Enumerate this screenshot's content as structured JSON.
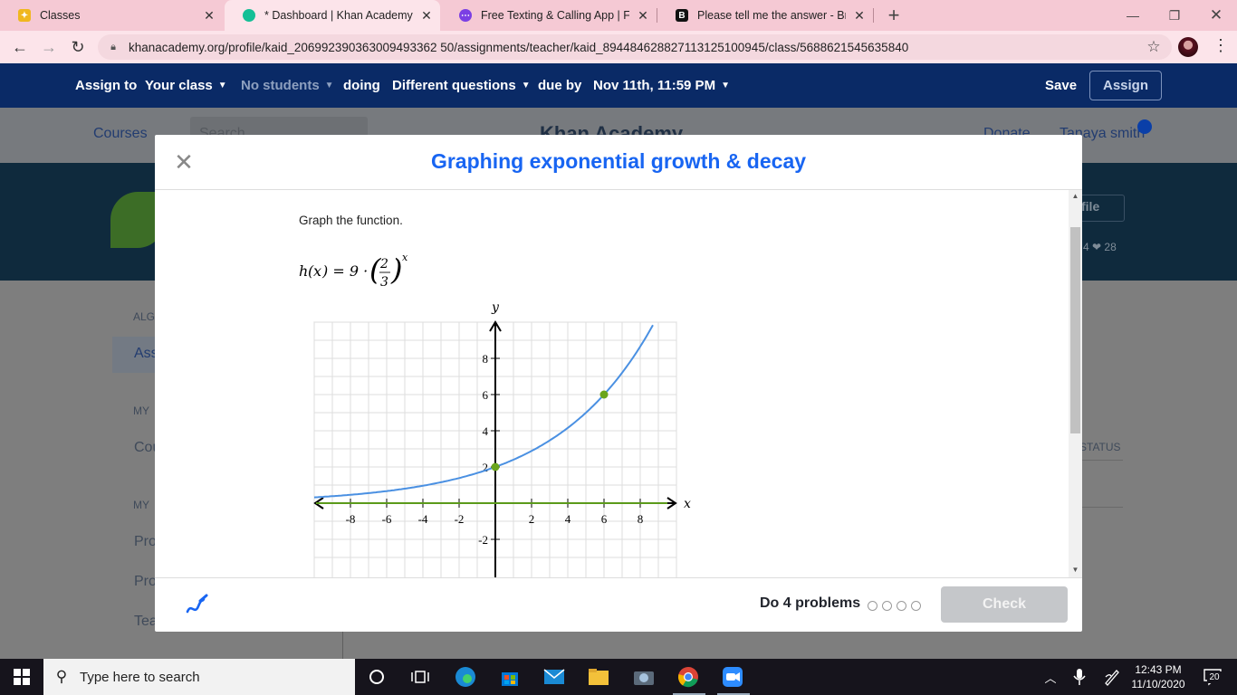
{
  "browser": {
    "tabs": [
      {
        "title": "Classes",
        "active": false,
        "favicon_color": "#f0b71f"
      },
      {
        "title": "* Dashboard | Khan Academy",
        "active": true,
        "favicon_color": "#14bf96"
      },
      {
        "title": "Free Texting & Calling App | Free",
        "active": false,
        "favicon_color": "#7b3fe4"
      },
      {
        "title": "Please tell me the answer - Brainl",
        "active": false,
        "favicon_color": "#111111"
      }
    ],
    "url": "khanacademy.org/profile/kaid_206992390363009493362 50/assignments/teacher/kaid_894484628827113125100945/class/5688621545635840"
  },
  "assign_bar": {
    "assign_to": "Assign to",
    "your_class": "Your class",
    "no_students": "No students",
    "doing": "doing",
    "different_questions": "Different questions",
    "due_by": "due by",
    "due_date": "Nov 11th, 11:59 PM",
    "save": "Save",
    "assign": "Assign"
  },
  "background_page": {
    "courses": "Courses",
    "search": "Search",
    "logo": "Khan Academy",
    "donate": "Donate",
    "user": "Tanaya smith",
    "edit_profile": "file",
    "stats": "4 ❤ 28",
    "sidebar_algebra": "ALG",
    "sidebar_assign": "Ass",
    "sidebar_my1": "MY",
    "sidebar_courses": "Cou",
    "sidebar_my2": "MY",
    "sidebar_pro1": "Pro",
    "sidebar_pro2": "Pro",
    "sidebar_tea": "Tea",
    "status_col": "STATUS"
  },
  "modal": {
    "title": "Graphing exponential growth & decay",
    "prompt": "Graph the function.",
    "do_problems": "Do 4 problems",
    "check": "Check"
  },
  "chart_data": {
    "type": "line",
    "function": "h(x) = 9 * (2/3)^x",
    "xlabel": "x",
    "ylabel": "y",
    "xlim": [
      -10,
      10
    ],
    "ylim": [
      -3.5,
      10
    ],
    "x_ticks": [
      -8,
      -6,
      -4,
      -2,
      2,
      4,
      6,
      8
    ],
    "y_ticks": [
      -2,
      2,
      4,
      6,
      8
    ],
    "grid": true,
    "series": [
      {
        "type": "exponential_curve",
        "color": "#4a90e2",
        "points": [
          [
            0,
            2
          ],
          [
            6,
            6
          ]
        ]
      },
      {
        "type": "asymptote",
        "color": "#5b9a1a",
        "y": 0
      }
    ],
    "control_points": [
      {
        "x": 0,
        "y": 2
      },
      {
        "x": 6,
        "y": 6
      }
    ]
  },
  "taskbar": {
    "search_placeholder": "Type here to search",
    "time": "12:43 PM",
    "date": "11/10/2020",
    "notifications": "20"
  }
}
